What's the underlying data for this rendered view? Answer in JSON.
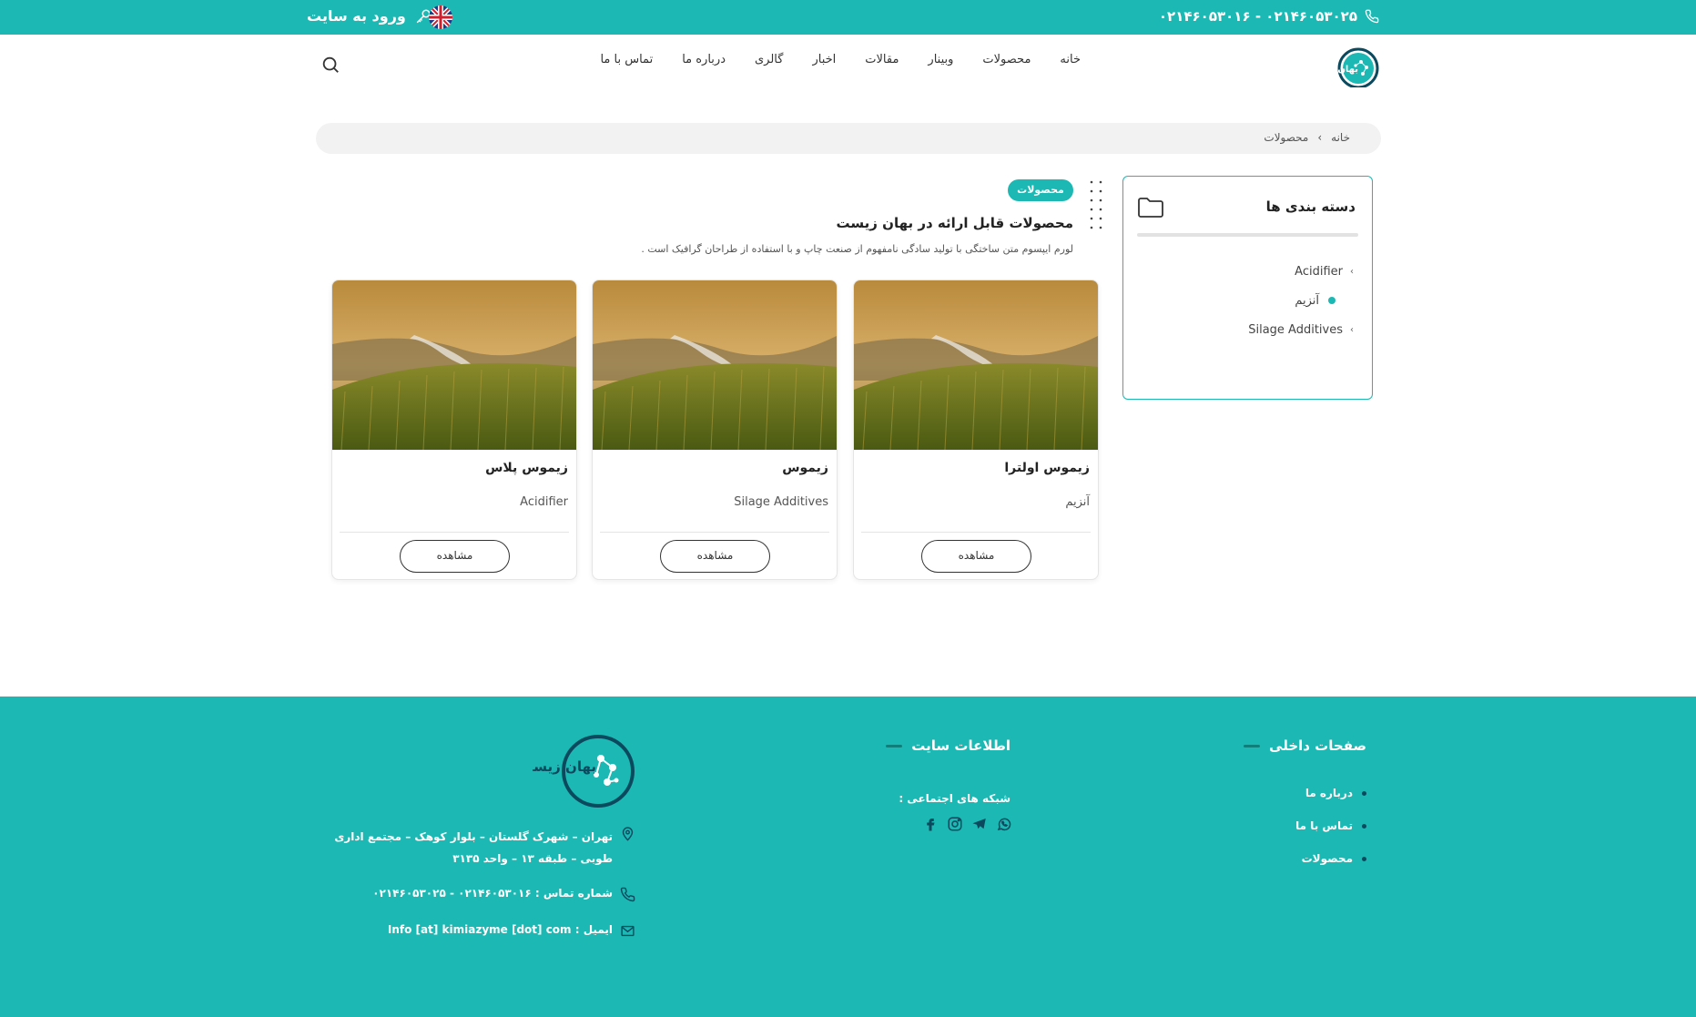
{
  "topbar": {
    "phone": "۰۲۱۴۶۰۵۳۰۱۶ - ۰۲۱۴۶۰۵۳۰۲۵",
    "login_label": "ورود به سایت"
  },
  "logo_text": "بهان زیست",
  "nav": {
    "items": [
      "خانه",
      "محصولات",
      "وبینار",
      "مقالات",
      "اخبار",
      "گالری",
      "درباره ما",
      "تماس با ما"
    ]
  },
  "breadcrumb": {
    "home": "خانه",
    "current": "محصولات"
  },
  "sidebar": {
    "title": "دسته بندی ها",
    "categories": [
      {
        "label": "Acidifier"
      },
      {
        "label": "آنزیم"
      },
      {
        "label": "Silage Additives"
      }
    ]
  },
  "intro": {
    "tag": "محصولات",
    "title": "محصولات قابل ارائه در بهان زیست",
    "description": "لورم ایپسوم متن ساختگی با تولید سادگی نامفهوم از صنعت چاپ و با استفاده از طراحان گرافیک است ."
  },
  "products": [
    {
      "name": "زیموس اولترا",
      "category": "آنزیم",
      "button": "مشاهده"
    },
    {
      "name": "زیموس",
      "category": "Silage Additives",
      "button": "مشاهده"
    },
    {
      "name": "زیموس پلاس",
      "category": "Acidifier",
      "button": "مشاهده"
    }
  ],
  "footer": {
    "internal_title": "صفحات داخلی",
    "internal_links": [
      "درباره ما",
      "تماس با ما",
      "محصولات"
    ],
    "site_info_title": "اطلاعات سایت",
    "social_label": "شبکه های اجتماعی :",
    "logo_text": "بهان زیست",
    "address": "تهران – شهرک گلستان – بلوار کوهک – مجتمع اداری طوبی – طبقه ۱۳ – واحد ۳۱۳۵",
    "phone": "شماره تماس : ۰۲۱۴۶۰۵۳۰۱۶ - ۰۲۱۴۶۰۵۳۰۲۵",
    "email": "ایمیل : Info [at] kimiazyme [dot] com"
  },
  "colors": {
    "accent": "#1cb8b3",
    "footer_dash": "#0f7f7c"
  }
}
